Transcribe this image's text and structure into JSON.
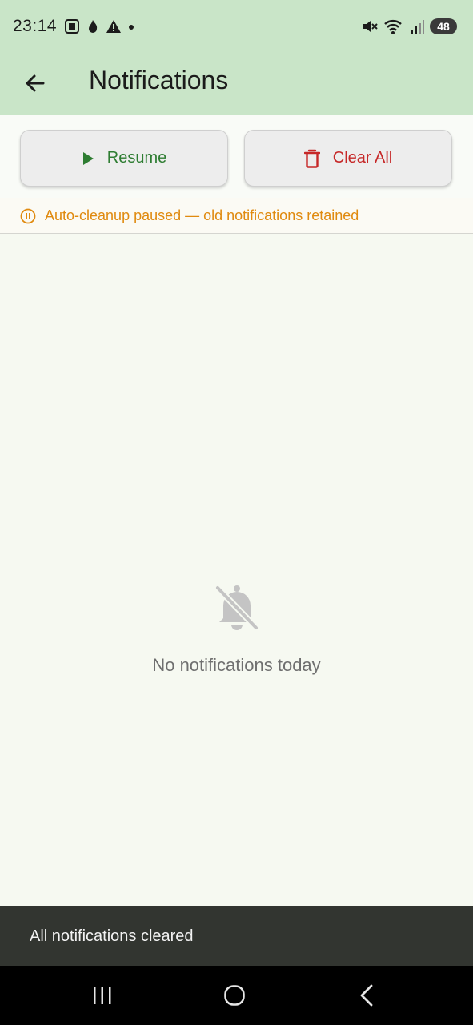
{
  "status_bar": {
    "time": "23:14",
    "battery": "48",
    "icons": [
      "screenshot-icon",
      "fire-icon",
      "warning-icon",
      "dot-icon",
      "mute-icon",
      "wifi-6e-icon",
      "signal-icon",
      "battery-icon"
    ]
  },
  "app_bar": {
    "title": "Notifications",
    "back_icon": "arrow-back-icon"
  },
  "actions": {
    "resume_label": "Resume",
    "clear_all_label": "Clear All"
  },
  "banner": {
    "text": "Auto-cleanup paused — old notifications retained",
    "icon": "pause-circle-icon"
  },
  "empty_state": {
    "icon": "notifications-off-icon",
    "text": "No notifications today"
  },
  "snackbar": {
    "text": "All notifications cleared"
  },
  "nav_bar": {
    "items": [
      "recent-apps-icon",
      "home-icon",
      "back-icon"
    ]
  },
  "colors": {
    "app_bar": "#c9e5c8",
    "resume": "#2e7d32",
    "clear": "#c62828",
    "banner_text": "#e08a0f"
  }
}
